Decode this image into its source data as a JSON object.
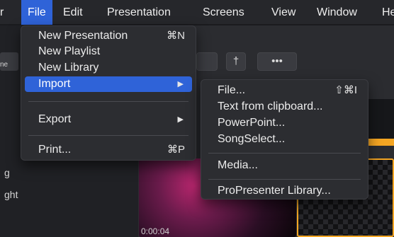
{
  "menubar": {
    "apple_fragment": "r",
    "items": [
      "File",
      "Edit",
      "Presentation",
      "Screens",
      "View",
      "Window",
      "He"
    ]
  },
  "file_menu": {
    "new_presentation": {
      "label": "New Presentation",
      "shortcut": "⌘N"
    },
    "new_playlist": {
      "label": "New Playlist"
    },
    "new_library": {
      "label": "New Library"
    },
    "import": {
      "label": "Import",
      "submenu_arrow": "▶"
    },
    "export": {
      "label": "Export",
      "submenu_arrow": "▶"
    },
    "print": {
      "label": "Print...",
      "shortcut": "⌘P"
    }
  },
  "import_menu": {
    "file": {
      "label": "File...",
      "shortcut": "⇧⌘I"
    },
    "text_from_clipboard": {
      "label": "Text from clipboard..."
    },
    "powerpoint": {
      "label": "PowerPoint..."
    },
    "songselect": {
      "label": "SongSelect..."
    },
    "media": {
      "label": "Media..."
    },
    "propresenter_library": {
      "label": "ProPresenter Library..."
    }
  },
  "background": {
    "toolbar_more": "•••",
    "toolbar_cross": "†",
    "side_fragments": [
      "ne",
      "g",
      "ght"
    ],
    "timecode": "0:00:04",
    "colors": {
      "accent": "#2f63d8",
      "selection_border": "#f5a623"
    }
  }
}
